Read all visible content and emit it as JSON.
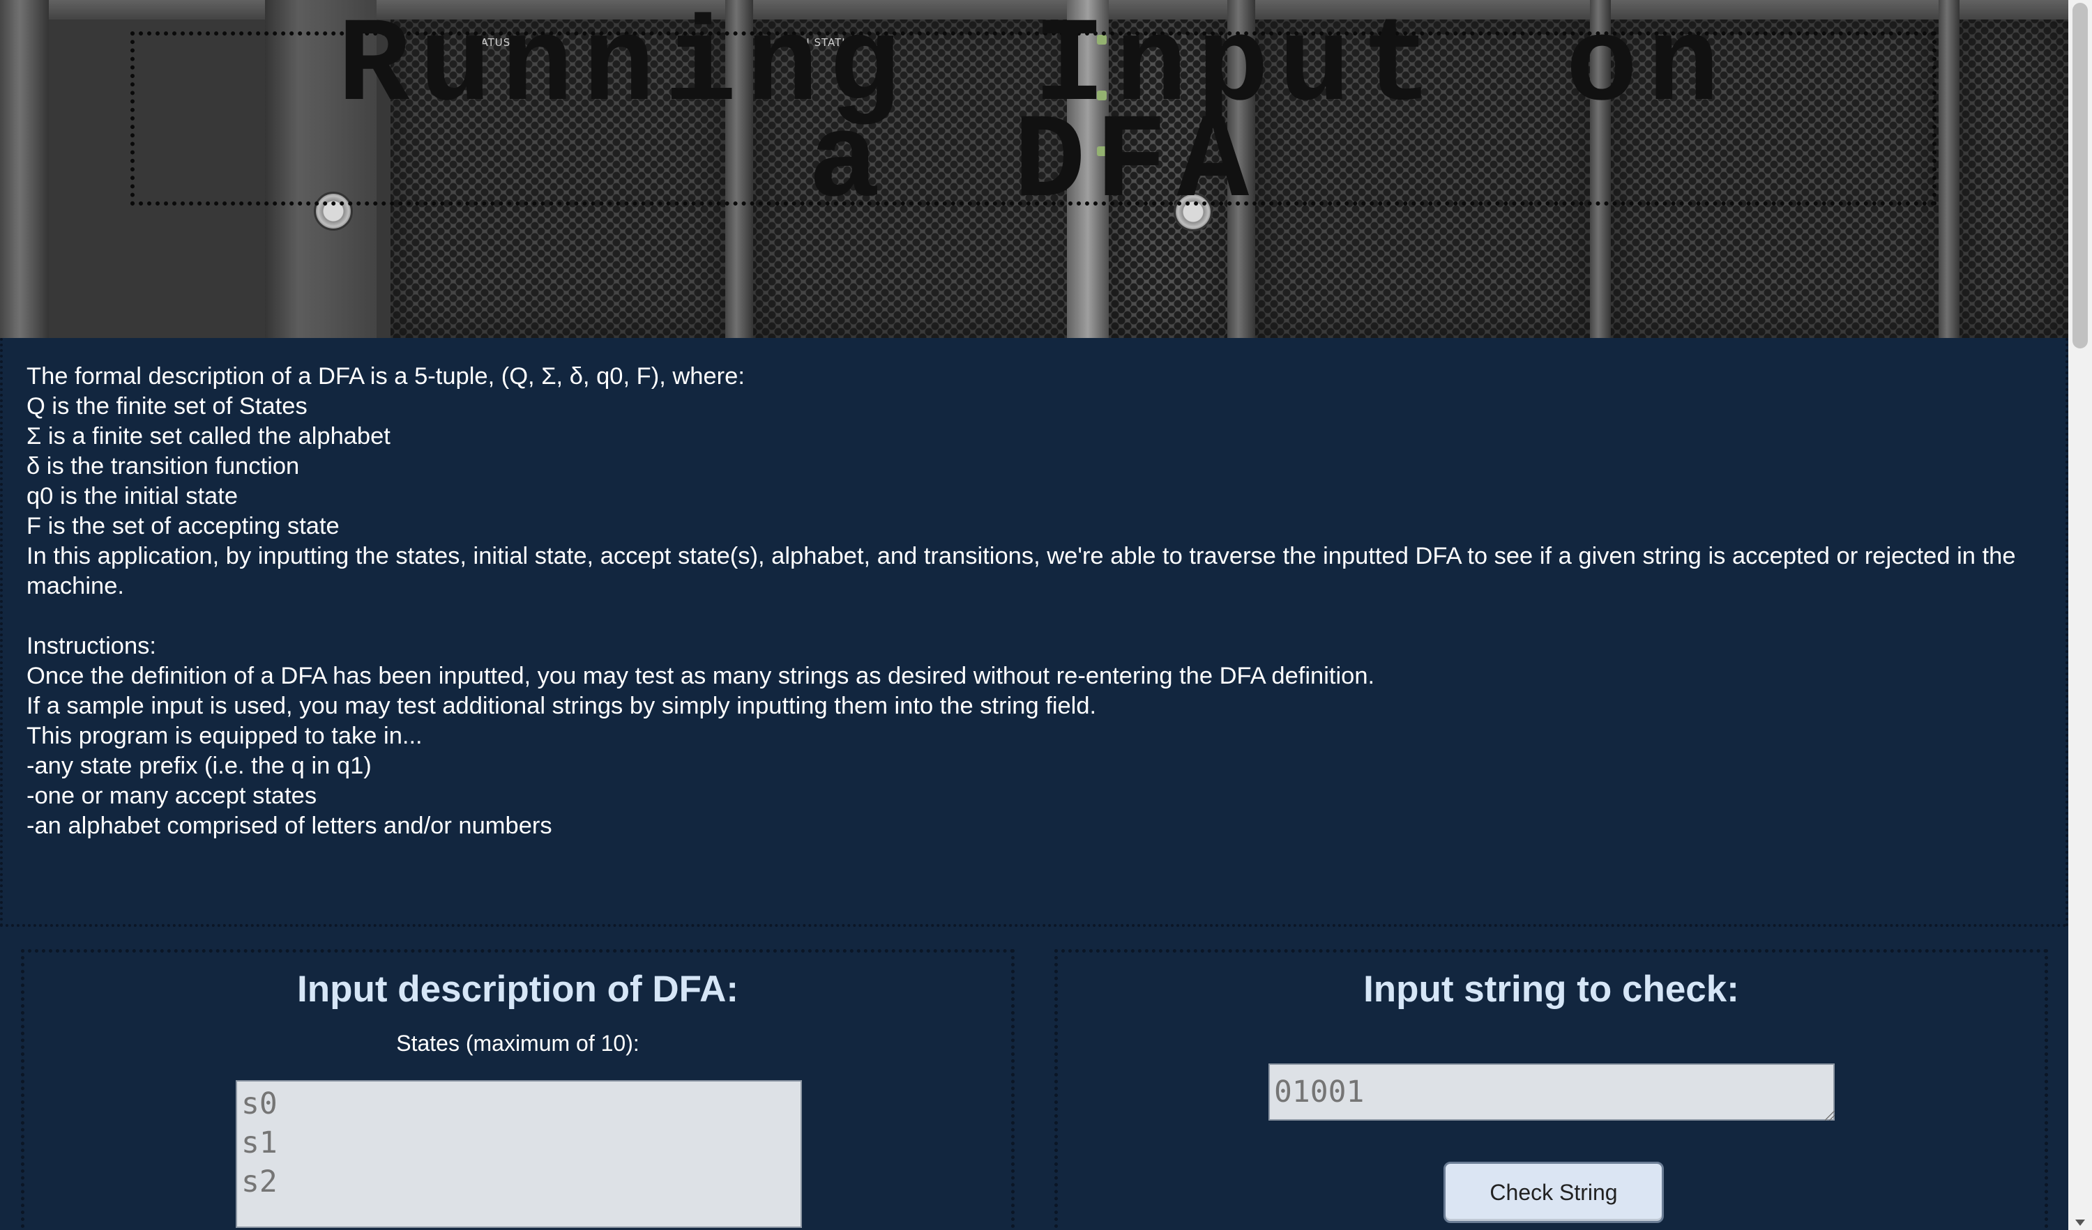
{
  "header": {
    "title": "Running Input on a DFA",
    "server_labels": [
      "STATUS",
      "FAN STATUS"
    ]
  },
  "description": {
    "lines": [
      "The formal description of a DFA is a 5-tuple, (Q, Σ, δ, q0, F), where:",
      "Q is the finite set of States",
      "Σ is a finite set called the alphabet",
      "δ is the transition function",
      "q0 is the initial state",
      "F is the set of accepting state",
      "In this application, by inputting the states, initial state, accept state(s), alphabet, and transitions, we're able to traverse the inputted DFA to see if a given string is accepted or rejected in the machine."
    ],
    "instructions": [
      "Instructions:",
      "Once the definition of a DFA has been inputted, you may test as many strings as desired without re-entering the DFA definition.",
      "If a sample input is used, you may test additional strings by simply inputting them into the string field.",
      "This program is equipped to take in...",
      "-any state prefix (i.e. the q in q1)",
      "-one or many accept states",
      "-an alphabet comprised of letters and/or numbers"
    ]
  },
  "dfa_panel": {
    "heading": "Input description of DFA:",
    "states_label": "States (maximum of 10):",
    "states_placeholder": "s0\ns1\ns2"
  },
  "string_panel": {
    "heading": "Input string to check:",
    "string_placeholder": "01001",
    "check_button_label": "Check String"
  },
  "colors": {
    "background": "#12263f",
    "heading": "#d6e6f7",
    "input_bg": "#dde1e6",
    "button_bg": "#dbe5f3"
  }
}
